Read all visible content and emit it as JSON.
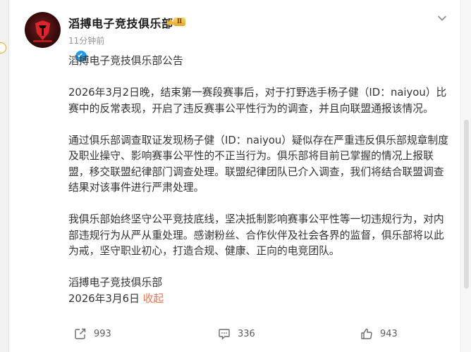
{
  "post": {
    "author": "滔搏电子竞技俱乐部",
    "badge_level": "Ⅱ",
    "time": "11分钟前",
    "paragraphs": [
      "滔搏电子竞技俱乐部公告",
      "2026年3月2日晚，结束第一赛段赛事后，对于打野选手杨子健（ID：naiyou）比赛中的反常表现，开启了违反赛事公平性行为的调查，并且向联盟通报该情况。",
      "通过俱乐部调查取证发现杨子健（ID：naiyou）疑似存在严重违反俱乐部规章制度及职业操守、影响赛事公平性的不正当行为。俱乐部将目前已掌握的情况上报联盟，移交联盟纪律部门调查处理。联盟纪律团队已介入调查，我们将结合联盟调查结果对该事件进行严肃处理。",
      "我俱乐部始终坚守公平竞技底线，坚决抵制影响赛事公平性等一切违规行为，对内部违规行为从严从重处理。感谢粉丝、合作伙伴及社会各界的监督，俱乐部将以此为戒，坚守职业初心，打造合规、健康、正向的电竞团队。"
    ],
    "signature": "滔搏电子竞技俱乐部",
    "date": "2026年3月6日",
    "collapse_label": "收起"
  },
  "actions": {
    "repost_count": "993",
    "comment_count": "336",
    "like_count": "943"
  },
  "colors": {
    "accent": "#eb7350",
    "verified": "#1f9bf0",
    "text": "#333333",
    "muted": "#939393"
  },
  "icons": {
    "more": "chevron-down-icon",
    "repost": "share-icon",
    "comment": "comment-icon",
    "like": "thumbs-up-icon",
    "verified": "verified-badge-icon",
    "level": "crown-level-badge-icon"
  }
}
